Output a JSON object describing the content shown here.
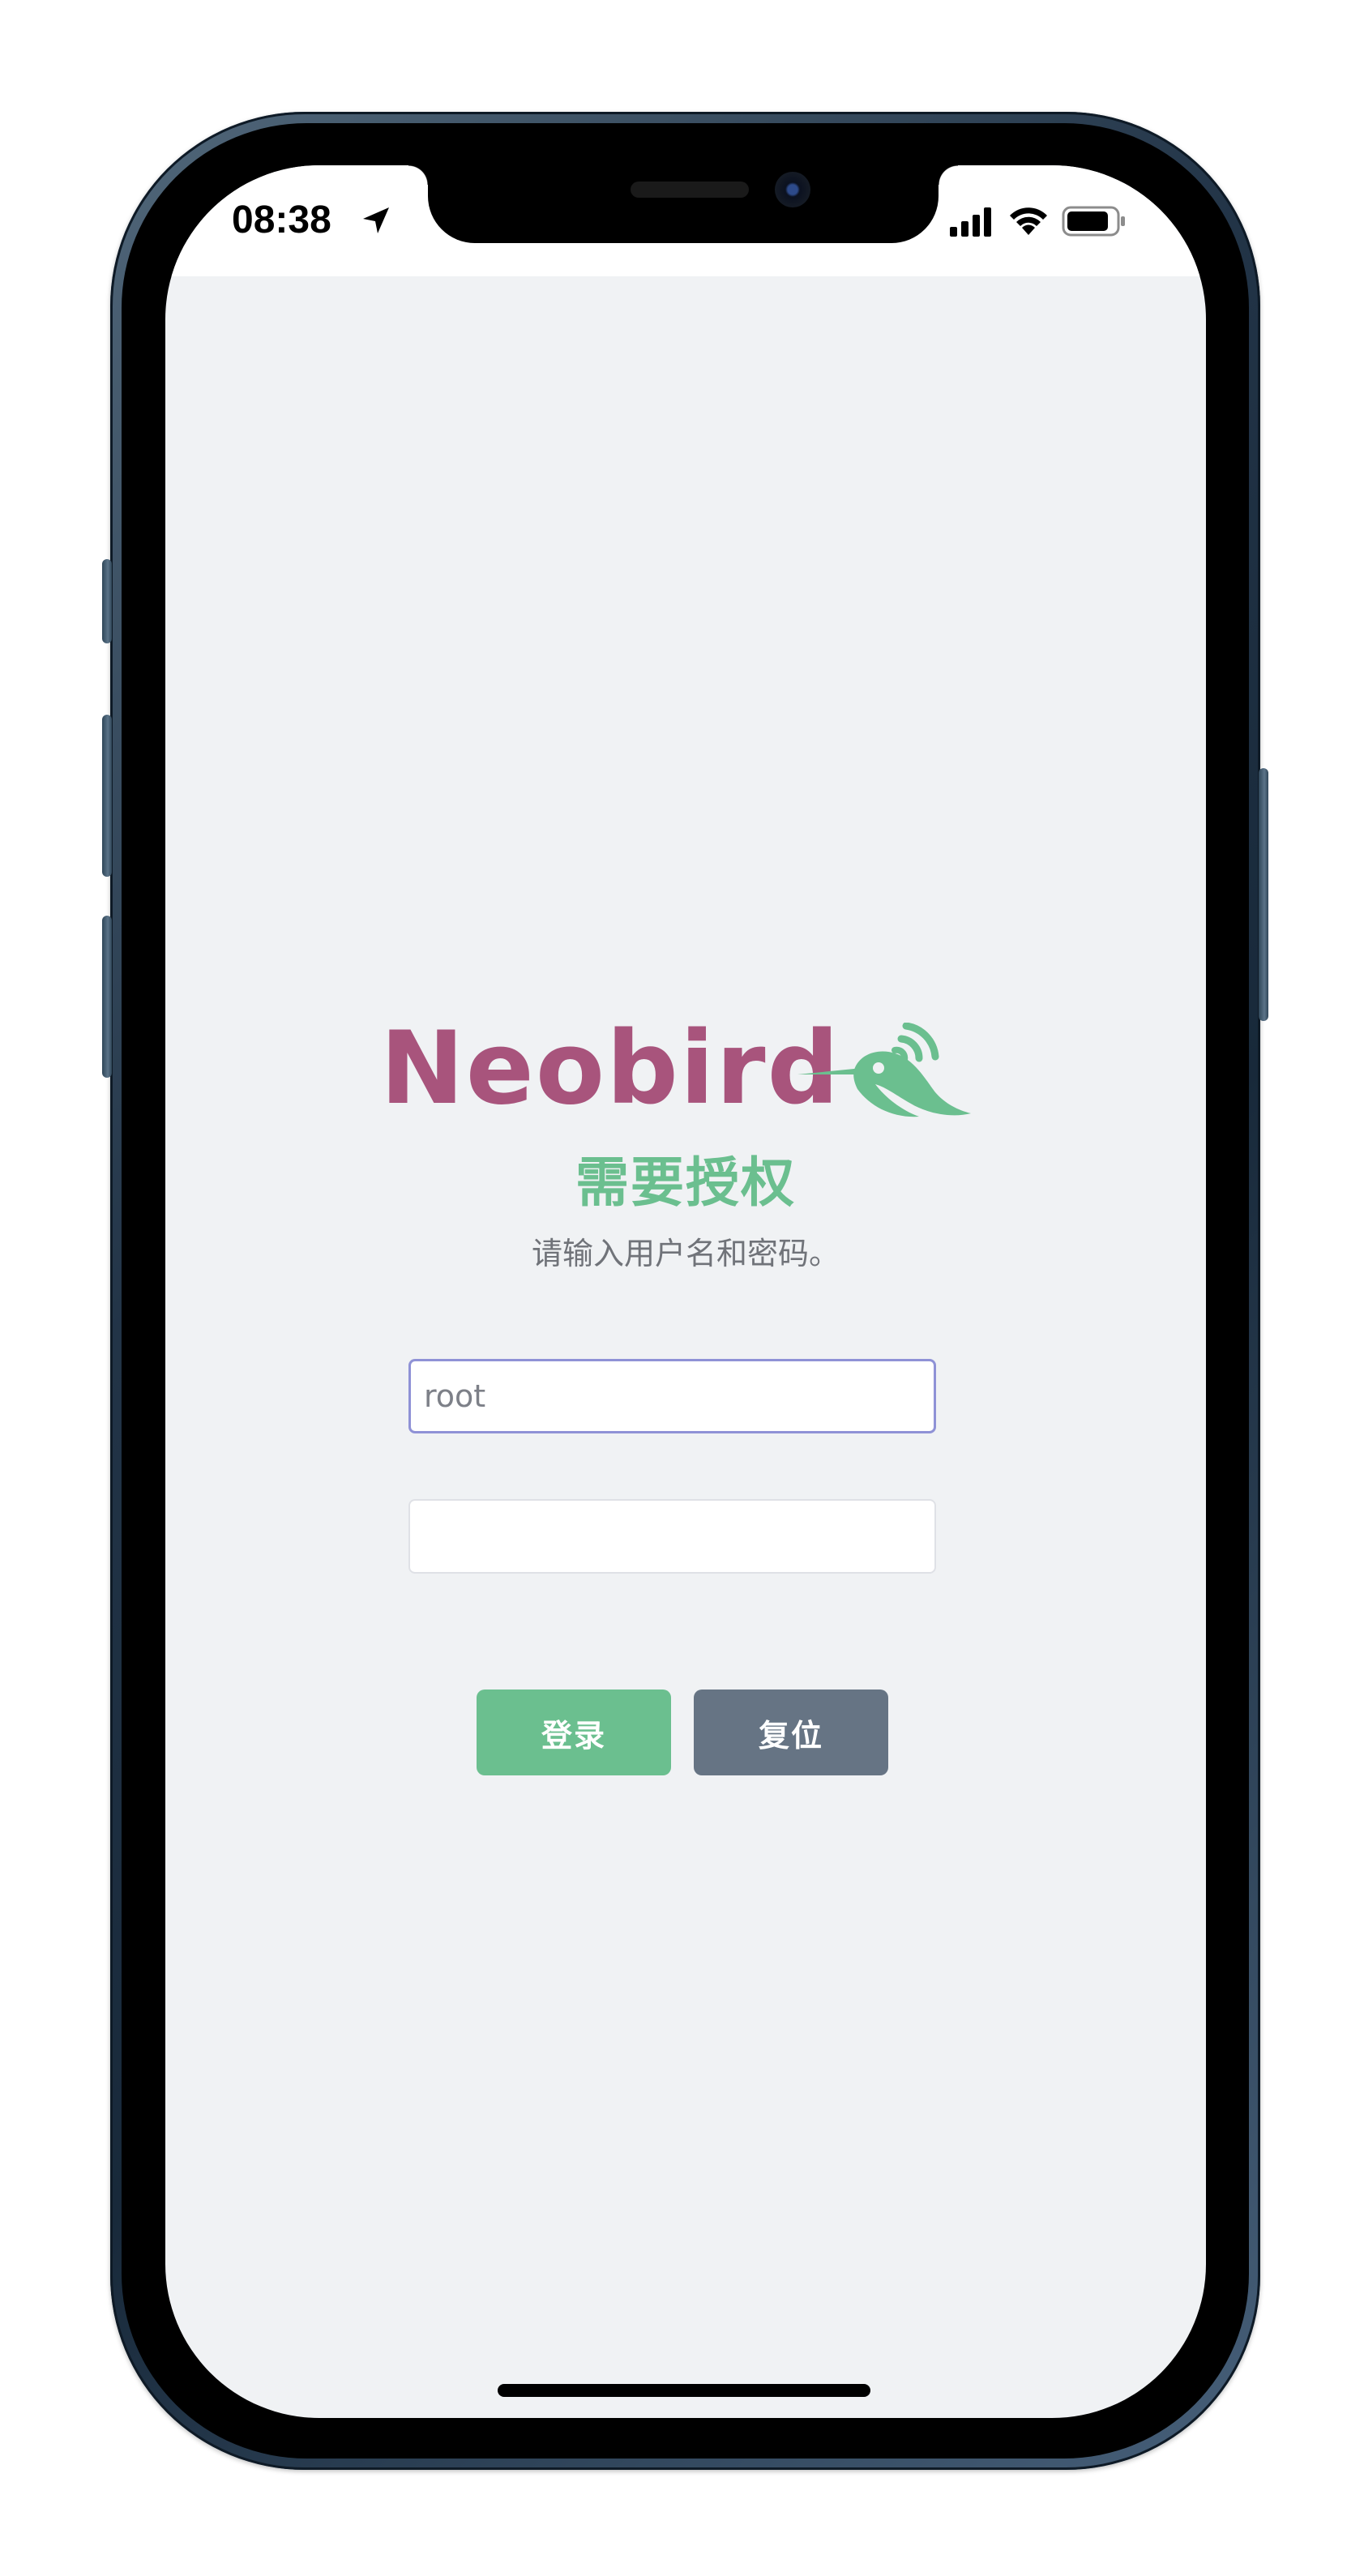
{
  "status_bar": {
    "time": "08:38",
    "icons": [
      "location-arrow-icon",
      "cellular-signal-icon",
      "wifi-icon",
      "battery-icon"
    ]
  },
  "logo": {
    "text": "Neobird",
    "icon": "hummingbird-icon",
    "colors": {
      "text": "#a8547c",
      "bird": "#6bbf8f"
    }
  },
  "auth": {
    "title": "需要授权",
    "subtitle": "请输入用户名和密码。"
  },
  "form": {
    "username_value": "root",
    "password_value": ""
  },
  "buttons": {
    "login": "登录",
    "reset": "复位"
  },
  "colors": {
    "accent_green": "#6bbf8f",
    "reset_gray": "#667484",
    "focus_border": "#8f92d6",
    "background": "#f0f2f4"
  }
}
